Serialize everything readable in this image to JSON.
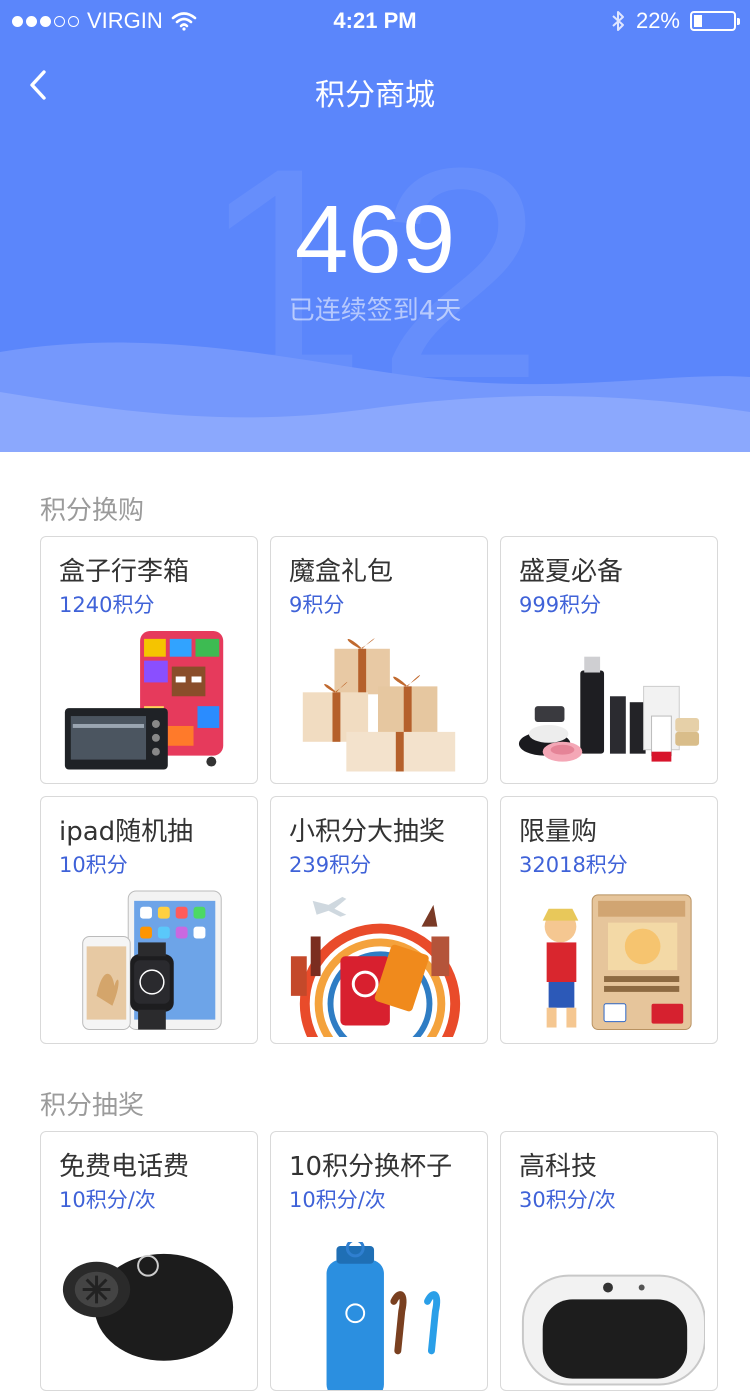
{
  "status_bar": {
    "carrier": "VIRGIN",
    "time": "4:21 PM",
    "battery": "22%",
    "battery_level": 0.22,
    "signal_filled": 3,
    "signal_total": 5
  },
  "nav": {
    "title": "积分商城",
    "back_icon": "chevron-left-icon"
  },
  "hero": {
    "points": "469",
    "streak_text": "已连续签到4天",
    "background_number": "12"
  },
  "colors": {
    "header_blue": "#5b86fb",
    "price_blue": "#3f62d8",
    "section_gray": "#9b9b9b"
  },
  "sections": [
    {
      "title": "积分换购",
      "items": [
        {
          "name": "盒子行李箱",
          "price": "1240积分",
          "image": "luggage-and-oven-image"
        },
        {
          "name": "魔盒礼包",
          "price": "9积分",
          "image": "gift-boxes-image"
        },
        {
          "name": "盛夏必备",
          "price": "999积分",
          "image": "cosmetics-image"
        },
        {
          "name": "ipad随机抽",
          "price": "10积分",
          "image": "apple-devices-image"
        },
        {
          "name": "小积分大抽奖",
          "price": "239积分",
          "image": "travel-passport-image"
        },
        {
          "name": "限量购",
          "price": "32018积分",
          "image": "one-piece-card-image"
        }
      ]
    },
    {
      "title": "积分抽奖",
      "items": [
        {
          "name": "免费电话费",
          "price": "10积分/次",
          "image": "speaker-image"
        },
        {
          "name": "10积分换杯子",
          "price": "10积分/次",
          "image": "blue-bottle-image"
        },
        {
          "name": "高科技",
          "price": "30积分/次",
          "image": "tech-device-image"
        }
      ]
    }
  ]
}
